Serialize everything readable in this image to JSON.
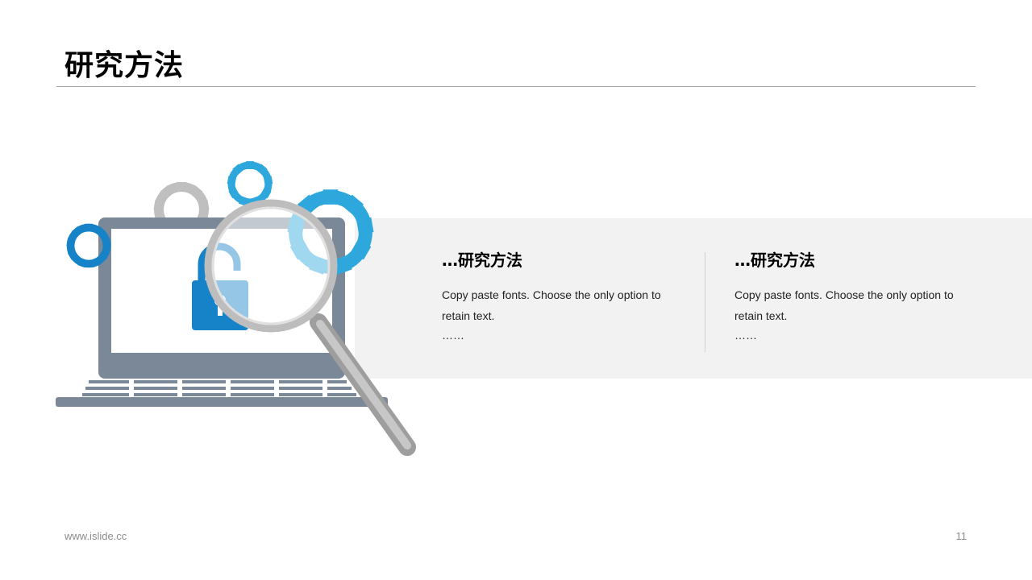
{
  "slide": {
    "title": "研究方法",
    "columns": [
      {
        "heading": "…研究方法",
        "body": "Copy paste fonts. Choose the only option to retain text.",
        "more": "……"
      },
      {
        "heading": "…研究方法",
        "body": "Copy paste fonts. Choose the only option to retain text.",
        "more": "……"
      }
    ]
  },
  "footer": {
    "url": "www.islide.cc",
    "page_number": "11"
  },
  "colors": {
    "accent_blue": "#2ea8dc",
    "dark_blue": "#1682c8",
    "light_blue": "#7ec4e4",
    "laptop_gray": "#7b8898",
    "gear_gray": "#bfbfbf",
    "band": "#f2f2f2"
  },
  "icons": [
    "gear-icon",
    "laptop-icon",
    "padlock-icon",
    "magnifier-icon"
  ]
}
